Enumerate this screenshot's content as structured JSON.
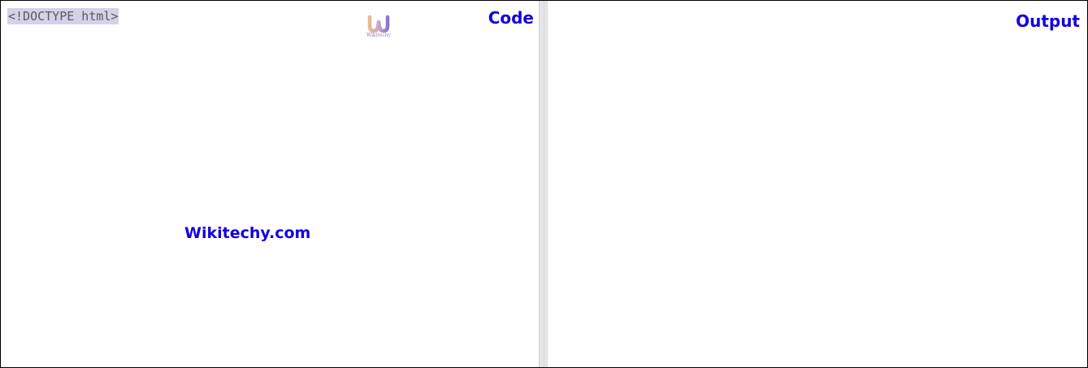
{
  "code_pane": {
    "title": "Code",
    "code_lines": [
      "<!DOCTYPE html>"
    ],
    "watermark": "Wikitechy.com",
    "logo_text": "Wikitechy"
  },
  "output_pane": {
    "title": "Output"
  },
  "colors": {
    "accent": "#1400e0",
    "selection": "#d6d0ea",
    "splitter": "#e6e6e6"
  },
  "icons": {
    "logo": "wikitechy-logo-icon"
  }
}
